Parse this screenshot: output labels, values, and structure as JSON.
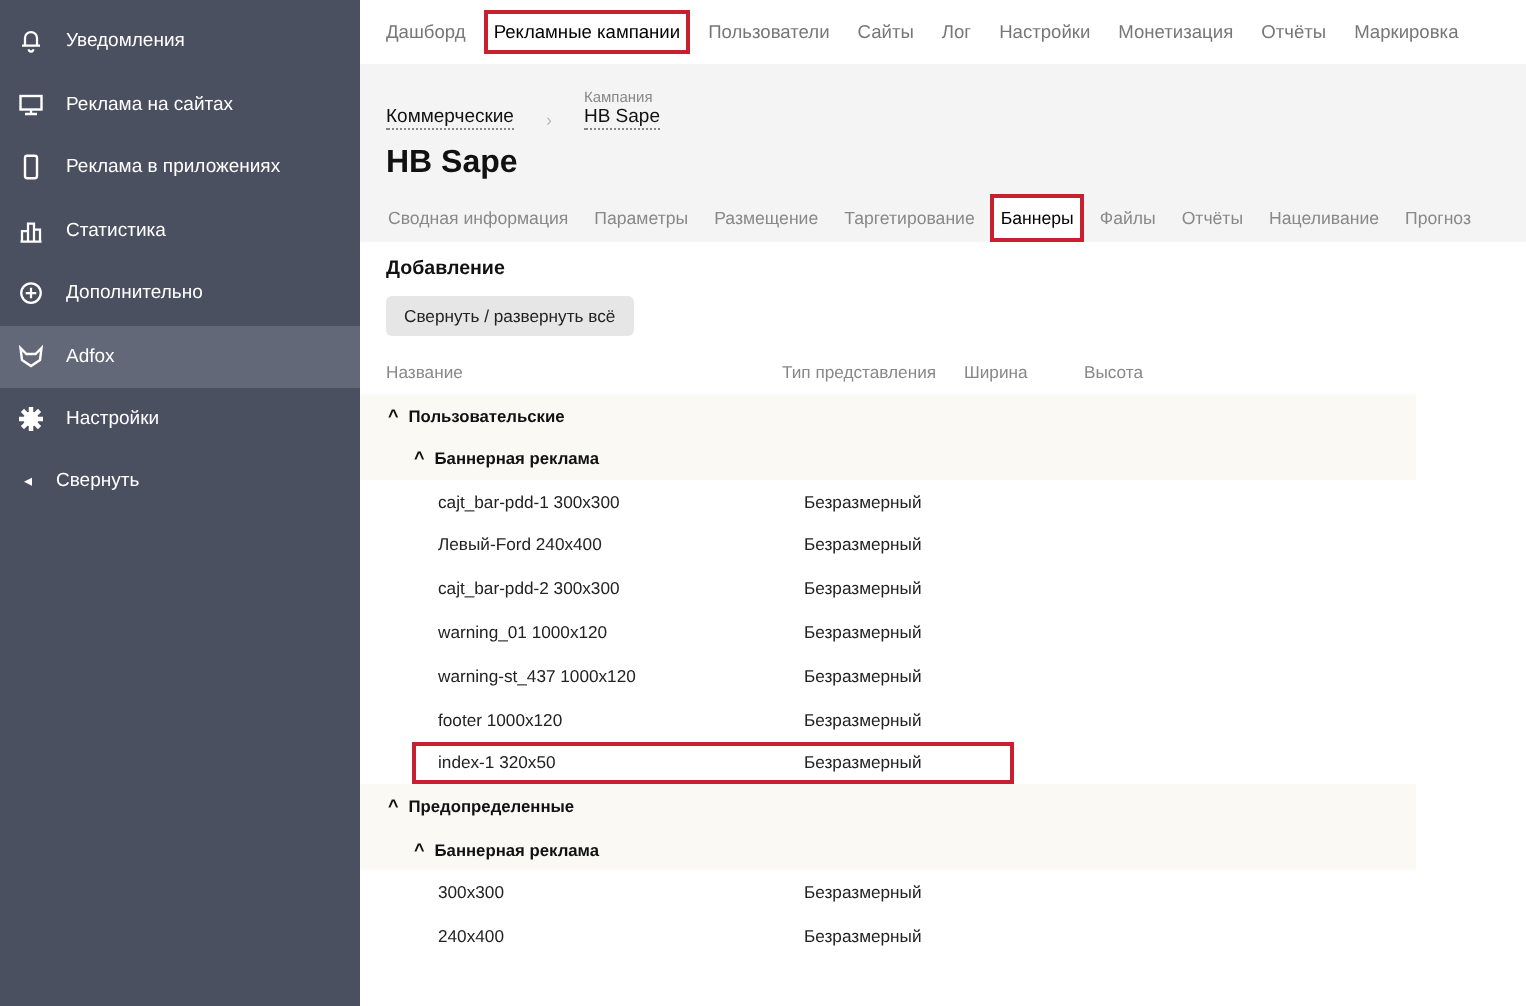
{
  "sidebar": {
    "items": [
      {
        "label": "Уведомления",
        "selected": false
      },
      {
        "label": "Реклама на сайтах",
        "selected": false
      },
      {
        "label": "Реклама в приложениях",
        "selected": false
      },
      {
        "label": "Статистика",
        "selected": false
      },
      {
        "label": "Дополнительно",
        "selected": false
      },
      {
        "label": "Adfox",
        "selected": true
      },
      {
        "label": "Настройки",
        "selected": false
      }
    ],
    "collapse": {
      "icon": "◂",
      "label": "Свернуть"
    }
  },
  "top_nav": [
    {
      "label": "Дашборд",
      "selected": false,
      "highlighted": false
    },
    {
      "label": "Рекламные кампании",
      "selected": true,
      "highlighted": true
    },
    {
      "label": "Пользователи",
      "selected": false,
      "highlighted": false
    },
    {
      "label": "Сайты",
      "selected": false,
      "highlighted": false
    },
    {
      "label": "Лог",
      "selected": false,
      "highlighted": false
    },
    {
      "label": "Настройки",
      "selected": false,
      "highlighted": false
    },
    {
      "label": "Монетизация",
      "selected": false,
      "highlighted": false
    },
    {
      "label": "Отчёты",
      "selected": false,
      "highlighted": false
    },
    {
      "label": "Маркировка",
      "selected": false,
      "highlighted": false
    }
  ],
  "breadcrumbs": {
    "parent": "Коммерческие",
    "separator": "›",
    "caption": "Кампания",
    "current": "HB Sape"
  },
  "title": "HB Sape",
  "tabs": [
    {
      "label": "Сводная информация",
      "selected": false,
      "highlighted": false
    },
    {
      "label": "Параметры",
      "selected": false,
      "highlighted": false
    },
    {
      "label": "Размещение",
      "selected": false,
      "highlighted": false
    },
    {
      "label": "Таргетирование",
      "selected": false,
      "highlighted": false
    },
    {
      "label": "Баннеры",
      "selected": true,
      "highlighted": true
    },
    {
      "label": "Файлы",
      "selected": false,
      "highlighted": false
    },
    {
      "label": "Отчёты",
      "selected": false,
      "highlighted": false
    },
    {
      "label": "Нацеливание",
      "selected": false,
      "highlighted": false
    },
    {
      "label": "Прогноз",
      "selected": false,
      "highlighted": false
    }
  ],
  "section_title": "Добавление",
  "toggle_button": "Свернуть / развернуть всё",
  "table": {
    "columns": [
      "Название",
      "Тип представления",
      "Ширина",
      "Высота"
    ],
    "groups": [
      {
        "icon": "^",
        "label": "Пользовательские",
        "expanded": true,
        "children": [
          {
            "icon": "^",
            "label": "Баннерная реклама",
            "expanded": true,
            "rows": [
              {
                "name": "cajt_bar-pdd-1 300x300",
                "type": "Безразмерный",
                "highlighted": false
              },
              {
                "name": "Левый-Ford 240x400",
                "type": "Безразмерный",
                "highlighted": false
              },
              {
                "name": "cajt_bar-pdd-2 300x300",
                "type": "Безразмерный",
                "highlighted": false
              },
              {
                "name": "warning_01 1000x120",
                "type": "Безразмерный",
                "highlighted": false
              },
              {
                "name": "warning-st_437 1000x120",
                "type": "Безразмерный",
                "highlighted": false
              },
              {
                "name": "footer 1000x120",
                "type": "Безразмерный",
                "highlighted": false
              },
              {
                "name": "index-1 320x50",
                "type": "Безразмерный",
                "highlighted": true
              }
            ]
          }
        ]
      },
      {
        "icon": "^",
        "label": "Предопределенные",
        "expanded": true,
        "children": [
          {
            "icon": "^",
            "label": "Баннерная реклама",
            "expanded": true,
            "rows": [
              {
                "name": "300x300",
                "type": "Безразмерный",
                "highlighted": false
              },
              {
                "name": "240x400",
                "type": "Безразмерный",
                "highlighted": false
              }
            ]
          }
        ]
      }
    ]
  }
}
